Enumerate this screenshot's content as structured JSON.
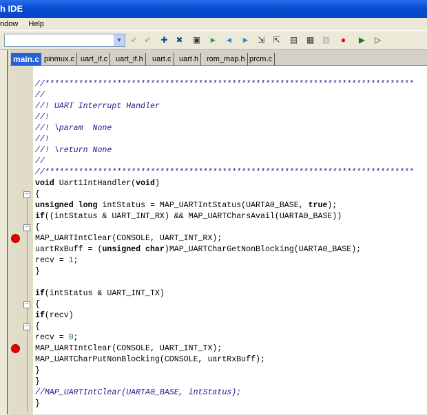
{
  "window": {
    "title": "h IDE"
  },
  "menu": [
    "ndow",
    "Help"
  ],
  "toolbar": {
    "combo_value": "",
    "icons": [
      "check-icon",
      "uncheck-icon",
      "add-watch-icon",
      "remove-watch-icon",
      "view-icon",
      "run-to-icon",
      "step-back-icon",
      "step-forward-icon",
      "step-into-icon",
      "step-out-icon",
      "memory-icon",
      "registers-icon",
      "disassembly-icon",
      "breakpoint-icon",
      "go-icon",
      "halt-icon"
    ]
  },
  "tabs": [
    "main.c",
    "pinmux.c",
    "uart_if.c",
    "uart_if.h",
    "uart.c",
    "uart.h",
    "rom_map.h",
    "prcm.c"
  ],
  "colors": {
    "breakpoint": "#e00000",
    "comment": "#1a1a8c",
    "number": "#1a7a1a"
  },
  "code": [
    [
      [
        "//*****************************************************************************",
        "cm"
      ]
    ],
    [
      [
        "//",
        "cm"
      ]
    ],
    [
      [
        "//! UART Interrupt Handler",
        "cm"
      ]
    ],
    [
      [
        "//!",
        "cm"
      ]
    ],
    [
      [
        "//! \\param  None",
        "cm"
      ]
    ],
    [
      [
        "//!",
        "cm"
      ]
    ],
    [
      [
        "//! \\return None",
        "cm"
      ]
    ],
    [
      [
        "//",
        "cm"
      ]
    ],
    [
      [
        "//*****************************************************************************",
        "cm"
      ]
    ],
    [
      [
        "void",
        "kw"
      ],
      [
        " Uart1IntHandler(",
        ""
      ],
      [
        "void",
        "kw"
      ],
      [
        ")",
        ""
      ]
    ],
    [
      [
        "{",
        ""
      ]
    ],
    [
      [
        "unsigned long",
        "kw"
      ],
      [
        " intStatus = MAP_UARTIntStatus(UARTA0_BASE, ",
        ""
      ],
      [
        "true",
        "kw"
      ],
      [
        ");",
        ""
      ]
    ],
    [
      [
        "if",
        "kw"
      ],
      [
        "((intStatus & UART_INT_RX) && MAP_UARTCharsAvail(UARTA0_BASE))",
        ""
      ]
    ],
    [
      [
        "{",
        ""
      ]
    ],
    [
      [
        "MAP_UARTIntClear(CONSOLE, UART_INT_RX);",
        ""
      ]
    ],
    [
      [
        "uartRxBuff = (",
        ""
      ],
      [
        "unsigned char",
        "kw"
      ],
      [
        ")MAP_UARTCharGetNonBlocking(UARTA0_BASE);",
        ""
      ]
    ],
    [
      [
        "recv = ",
        ""
      ],
      [
        "1",
        "nm"
      ],
      [
        ";",
        ""
      ]
    ],
    [
      [
        "}",
        ""
      ]
    ],
    [
      [
        "",
        ""
      ]
    ],
    [
      [
        "if",
        "kw"
      ],
      [
        "(intStatus & UART_INT_TX)",
        ""
      ]
    ],
    [
      [
        "{",
        ""
      ]
    ],
    [
      [
        "if",
        "kw"
      ],
      [
        "(recv)",
        ""
      ]
    ],
    [
      [
        "{",
        ""
      ]
    ],
    [
      [
        "recv = ",
        ""
      ],
      [
        "0",
        "nm"
      ],
      [
        ";",
        ""
      ]
    ],
    [
      [
        "MAP_UARTIntClear(CONSOLE, UART_INT_TX);",
        ""
      ]
    ],
    [
      [
        "MAP_UARTCharPutNonBlocking(CONSOLE, uartRxBuff);",
        ""
      ]
    ],
    [
      [
        "}",
        ""
      ]
    ],
    [
      [
        "}",
        ""
      ]
    ],
    [
      [
        "//MAP_UARTIntClear(UARTA0_BASE, intStatus);",
        "cm"
      ]
    ],
    [
      [
        "}",
        ""
      ]
    ]
  ],
  "fold_lines": [
    10,
    13,
    20,
    22
  ],
  "breakpoint_lines": [
    14,
    24
  ]
}
